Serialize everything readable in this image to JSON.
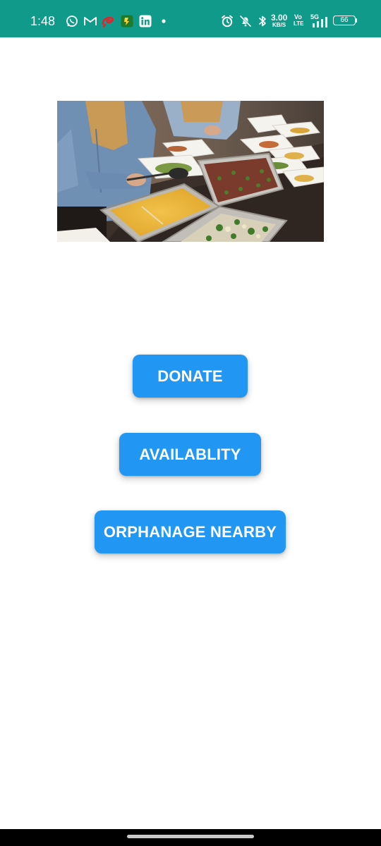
{
  "status_bar": {
    "time": "1:48",
    "net_speed_value": "3.00",
    "net_speed_unit": "KB/S",
    "volte_top": "Vo",
    "volte_bottom": "LTE",
    "network_type": "5G",
    "battery_level": "66",
    "icons": [
      "whatsapp-icon",
      "gmail-icon",
      "airtel-icon",
      "app-notification-icon",
      "linkedin-icon",
      "more-dot-icon",
      "alarm-icon",
      "mute-icon",
      "bluetooth-icon",
      "signal-icon",
      "battery-icon"
    ],
    "bg_color": "#0f9a8a"
  },
  "hero": {
    "image_desc_icon": "food-donation-photo"
  },
  "buttons": {
    "donate": "DONATE",
    "availability": "AVAILABLITY",
    "orphanage": "ORPHANAGE NEARBY",
    "color": "#2196f3"
  },
  "nav": {
    "handle_icon": "home-handle-icon"
  }
}
